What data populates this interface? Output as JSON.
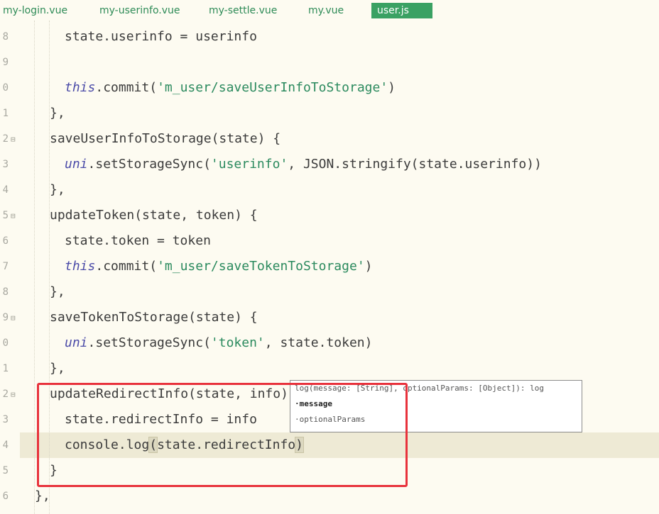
{
  "tabs": [
    {
      "label": "my-login.vue",
      "active": false
    },
    {
      "label": "my-userinfo.vue",
      "active": false
    },
    {
      "label": "my-settle.vue",
      "active": false
    },
    {
      "label": "my.vue",
      "active": false
    },
    {
      "label": "user.js",
      "active": true
    }
  ],
  "gutter": {
    "line_numbers": [
      "8",
      "9",
      "0",
      "1",
      "2",
      "3",
      "4",
      "5",
      "6",
      "7",
      "8",
      "9",
      "0",
      "1",
      "2",
      "3",
      "4",
      "5",
      "6"
    ],
    "fold_marker": "⊟"
  },
  "code": {
    "l18": "state.userinfo = userinfo",
    "l20_kw": "this",
    "l20_a": ".commit(",
    "l20_str": "'m_user/saveUserInfoToStorage'",
    "l20_b": ")",
    "l21": "},",
    "l22": "saveUserInfoToStorage(state) {",
    "l23_kw": "uni",
    "l23_a": ".setStorageSync(",
    "l23_str": "'userinfo'",
    "l23_b": ", JSON.stringify(state.userinfo))",
    "l24": "},",
    "l25": "updateToken(state, token) {",
    "l26": "state.token = token",
    "l27_kw": "this",
    "l27_a": ".commit(",
    "l27_str": "'m_user/saveTokenToStorage'",
    "l27_b": ")",
    "l28": "},",
    "l29": "saveTokenToStorage(state) {",
    "l30_kw": "uni",
    "l30_a": ".setStorageSync(",
    "l30_str": "'token'",
    "l30_b": ", state.token)",
    "l31": "},",
    "l32": "updateRedirectInfo(state, info) {",
    "l33": "state.redirectInfo = info",
    "l34_a": "console.log",
    "l34_open": "(",
    "l34_b": "state.redirectInfo",
    "l34_close": ")",
    "l35": "}",
    "l36": "},"
  },
  "tooltip": {
    "signature": "log(message: [String], optionalParams: [Object]): log",
    "param1": "message",
    "param2": "optionalParams"
  },
  "colors": {
    "tab_active": "#3aa163",
    "keyword": "#4b4ba8",
    "string": "#2b8a5e",
    "highlight_box": "#e8323c",
    "background": "#fdfbf1"
  }
}
